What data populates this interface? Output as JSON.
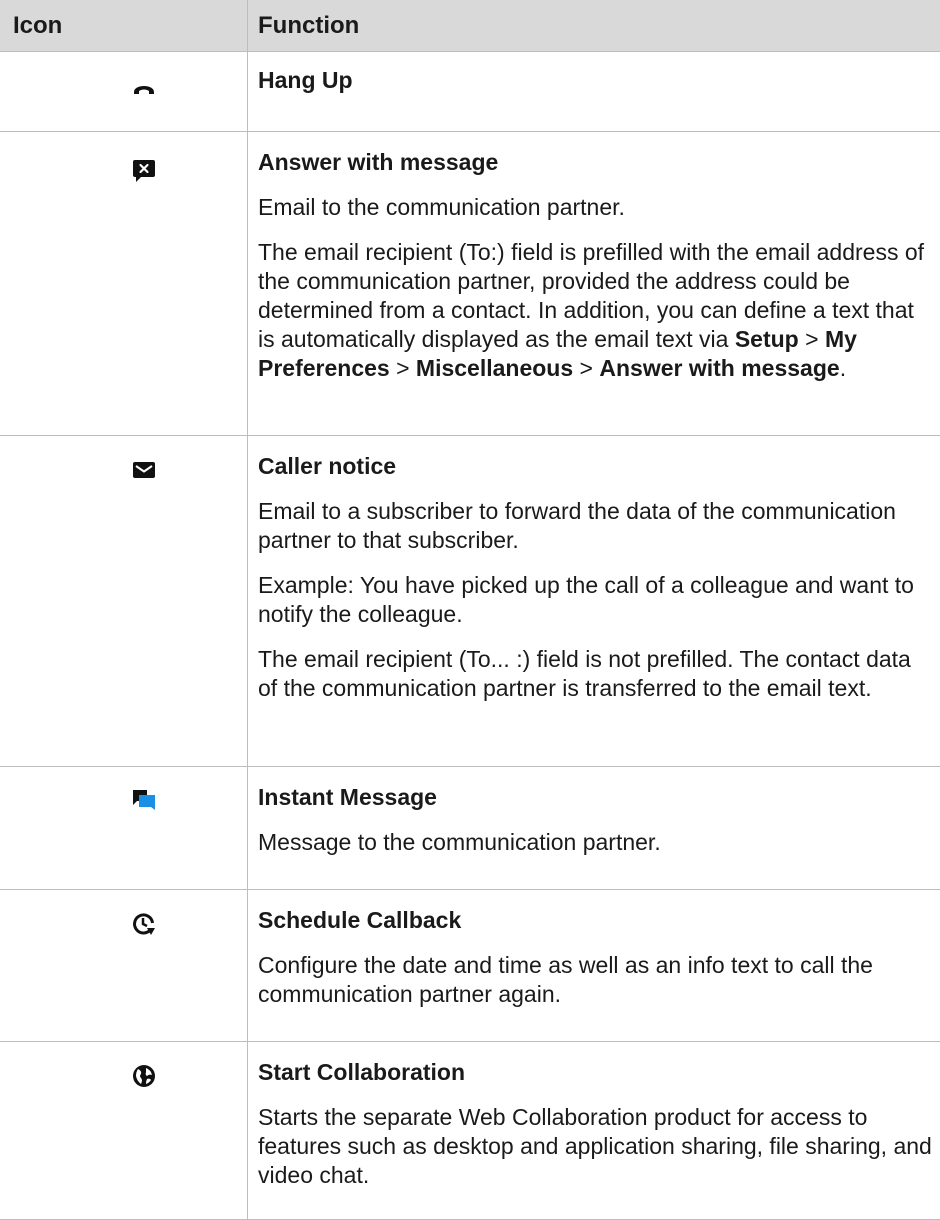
{
  "table": {
    "header": {
      "icon": "Icon",
      "function": "Function"
    },
    "rows": [
      {
        "icon": "hang-up-icon",
        "title": "Hang Up",
        "paras": []
      },
      {
        "icon": "answer-with-message-icon",
        "title": "Answer with message",
        "paras": [
          "Email to the communication partner.",
          "The email recipient (To:) field is prefilled with the email address of the communication partner, provided the address could be determined from a contact. In addition, you can define a text that is automatically displayed as the email text via",
          "Setup",
          " > ",
          "My Preferences",
          " > ",
          "Miscellaneous",
          " > ",
          "Answer with message",
          "."
        ]
      },
      {
        "icon": "envelope-icon",
        "title": "Caller notice",
        "paras": [
          "Email to a subscriber to forward the data of the communication partner to that subscriber.",
          "Example: You have picked up the call of a colleague and want to notify the colleague.",
          "The email recipient (To... :) field is not prefilled. The contact data of the communication partner is transferred to the email text."
        ]
      },
      {
        "icon": "instant-message-icon",
        "title": "Instant Message",
        "paras": [
          "Message to the communication partner."
        ]
      },
      {
        "icon": "schedule-callback-icon",
        "title": "Schedule Callback",
        "paras": [
          "Configure the date and time as well as an info text to call the communication partner again."
        ]
      },
      {
        "icon": "collaboration-globe-icon",
        "title": "Start Collaboration",
        "paras": [
          "Starts the separate Web Collaboration product for access to features such as desktop and application sharing, file sharing, and video chat."
        ]
      }
    ]
  },
  "colors": {
    "header_bg": "#d9d9d9",
    "border": "#bdbdbd",
    "im_blue": "#1a8fe6"
  }
}
